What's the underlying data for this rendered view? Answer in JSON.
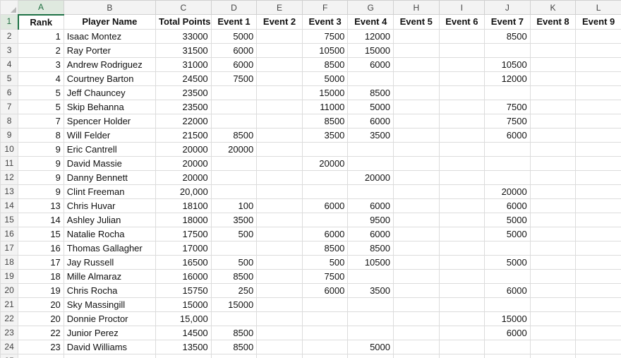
{
  "sheet": {
    "column_letters": [
      "A",
      "B",
      "C",
      "D",
      "E",
      "F",
      "G",
      "H",
      "I",
      "J",
      "K",
      "L"
    ],
    "header": [
      "Rank",
      "Player Name",
      "Total Points",
      "Event 1",
      "Event 2",
      "Event 3",
      "Event 4",
      "Event 5",
      "Event 6",
      "Event 7",
      "Event 8",
      "Event 9"
    ],
    "rows": [
      [
        "1",
        "Isaac Montez",
        "33000",
        "5000",
        "",
        "7500",
        "12000",
        "",
        "",
        "8500",
        "",
        ""
      ],
      [
        "2",
        "Ray Porter",
        "31500",
        "6000",
        "",
        "10500",
        "15000",
        "",
        "",
        "",
        "",
        ""
      ],
      [
        "3",
        "Andrew Rodriguez",
        "31000",
        "6000",
        "",
        "8500",
        "6000",
        "",
        "",
        "10500",
        "",
        ""
      ],
      [
        "4",
        "Courtney Barton",
        "24500",
        "7500",
        "",
        "5000",
        "",
        "",
        "",
        "12000",
        "",
        ""
      ],
      [
        "5",
        "Jeff Chauncey",
        "23500",
        "",
        "",
        "15000",
        "8500",
        "",
        "",
        "",
        "",
        ""
      ],
      [
        "5",
        "Skip Behanna",
        "23500",
        "",
        "",
        "11000",
        "5000",
        "",
        "",
        "7500",
        "",
        ""
      ],
      [
        "7",
        "Spencer Holder",
        "22000",
        "",
        "",
        "8500",
        "6000",
        "",
        "",
        "7500",
        "",
        ""
      ],
      [
        "8",
        "Will Felder",
        "21500",
        "8500",
        "",
        "3500",
        "3500",
        "",
        "",
        "6000",
        "",
        ""
      ],
      [
        "9",
        "Eric Cantrell",
        "20000",
        "20000",
        "",
        "",
        "",
        "",
        "",
        "",
        "",
        ""
      ],
      [
        "9",
        "David Massie",
        "20000",
        "",
        "",
        "20000",
        "",
        "",
        "",
        "",
        "",
        ""
      ],
      [
        "9",
        "Danny Bennett",
        "20000",
        "",
        "",
        "",
        "20000",
        "",
        "",
        "",
        "",
        ""
      ],
      [
        "9",
        "Clint Freeman",
        "20,000",
        "",
        "",
        "",
        "",
        "",
        "",
        "20000",
        "",
        ""
      ],
      [
        "13",
        "Chris Huvar",
        "18100",
        "100",
        "",
        "6000",
        "6000",
        "",
        "",
        "6000",
        "",
        ""
      ],
      [
        "14",
        "Ashley Julian",
        "18000",
        "3500",
        "",
        "",
        "9500",
        "",
        "",
        "5000",
        "",
        ""
      ],
      [
        "15",
        "Natalie Rocha",
        "17500",
        "500",
        "",
        "6000",
        "6000",
        "",
        "",
        "5000",
        "",
        ""
      ],
      [
        "16",
        "Thomas Gallagher",
        "17000",
        "",
        "",
        "8500",
        "8500",
        "",
        "",
        "",
        "",
        ""
      ],
      [
        "17",
        "Jay Russell",
        "16500",
        "500",
        "",
        "500",
        "10500",
        "",
        "",
        "5000",
        "",
        ""
      ],
      [
        "18",
        "Mille Almaraz",
        "16000",
        "8500",
        "",
        "7500",
        "",
        "",
        "",
        "",
        "",
        ""
      ],
      [
        "19",
        "Chris Rocha",
        "15750",
        "250",
        "",
        "6000",
        "3500",
        "",
        "",
        "6000",
        "",
        ""
      ],
      [
        "20",
        "Sky Massingill",
        "15000",
        "15000",
        "",
        "",
        "",
        "",
        "",
        "",
        "",
        ""
      ],
      [
        "20",
        "Donnie Proctor",
        "15,000",
        "",
        "",
        "",
        "",
        "",
        "",
        "15000",
        "",
        ""
      ],
      [
        "22",
        "Junior Perez",
        "14500",
        "8500",
        "",
        "",
        "",
        "",
        "",
        "6000",
        "",
        ""
      ],
      [
        "23",
        "David Williams",
        "13500",
        "8500",
        "",
        "",
        "5000",
        "",
        "",
        "",
        "",
        ""
      ]
    ],
    "row_numbers": [
      "1",
      "2",
      "3",
      "4",
      "5",
      "6",
      "7",
      "8",
      "9",
      "10",
      "11",
      "12",
      "13",
      "14",
      "15",
      "16",
      "17",
      "18",
      "19",
      "20",
      "21",
      "22",
      "23",
      "24",
      "25"
    ],
    "accent": "#1e7145"
  }
}
